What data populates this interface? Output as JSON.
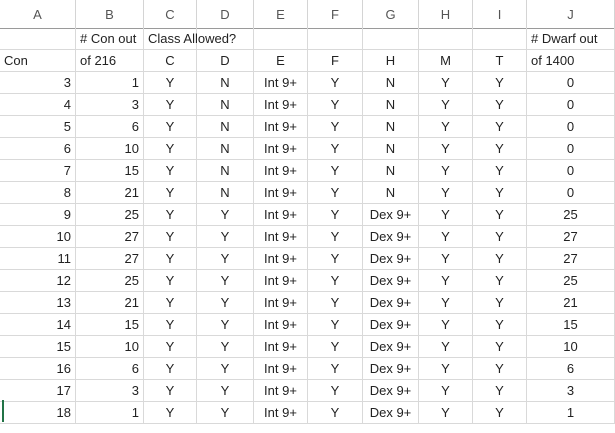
{
  "columns": [
    "A",
    "B",
    "C",
    "D",
    "E",
    "F",
    "G",
    "H",
    "I",
    "J"
  ],
  "header_row1": {
    "B": "# Con out",
    "C": "Class Allowed?",
    "J": "# Dwarf out"
  },
  "header_row2": {
    "A": "Con",
    "B": "of 216",
    "C": "C",
    "D": "D",
    "E": "E",
    "F": "F",
    "G": "H",
    "H": "M",
    "I": "T",
    "J": "of 1400"
  },
  "rows": [
    {
      "A": "3",
      "B": "1",
      "C": "Y",
      "D": "N",
      "E": "Int 9+",
      "F": "Y",
      "G": "N",
      "H": "Y",
      "I": "Y",
      "J": "0"
    },
    {
      "A": "4",
      "B": "3",
      "C": "Y",
      "D": "N",
      "E": "Int 9+",
      "F": "Y",
      "G": "N",
      "H": "Y",
      "I": "Y",
      "J": "0"
    },
    {
      "A": "5",
      "B": "6",
      "C": "Y",
      "D": "N",
      "E": "Int 9+",
      "F": "Y",
      "G": "N",
      "H": "Y",
      "I": "Y",
      "J": "0"
    },
    {
      "A": "6",
      "B": "10",
      "C": "Y",
      "D": "N",
      "E": "Int 9+",
      "F": "Y",
      "G": "N",
      "H": "Y",
      "I": "Y",
      "J": "0"
    },
    {
      "A": "7",
      "B": "15",
      "C": "Y",
      "D": "N",
      "E": "Int 9+",
      "F": "Y",
      "G": "N",
      "H": "Y",
      "I": "Y",
      "J": "0"
    },
    {
      "A": "8",
      "B": "21",
      "C": "Y",
      "D": "N",
      "E": "Int 9+",
      "F": "Y",
      "G": "N",
      "H": "Y",
      "I": "Y",
      "J": "0"
    },
    {
      "A": "9",
      "B": "25",
      "C": "Y",
      "D": "Y",
      "E": "Int 9+",
      "F": "Y",
      "G": "Dex 9+",
      "H": "Y",
      "I": "Y",
      "J": "25"
    },
    {
      "A": "10",
      "B": "27",
      "C": "Y",
      "D": "Y",
      "E": "Int 9+",
      "F": "Y",
      "G": "Dex 9+",
      "H": "Y",
      "I": "Y",
      "J": "27"
    },
    {
      "A": "11",
      "B": "27",
      "C": "Y",
      "D": "Y",
      "E": "Int 9+",
      "F": "Y",
      "G": "Dex 9+",
      "H": "Y",
      "I": "Y",
      "J": "27"
    },
    {
      "A": "12",
      "B": "25",
      "C": "Y",
      "D": "Y",
      "E": "Int 9+",
      "F": "Y",
      "G": "Dex 9+",
      "H": "Y",
      "I": "Y",
      "J": "25"
    },
    {
      "A": "13",
      "B": "21",
      "C": "Y",
      "D": "Y",
      "E": "Int 9+",
      "F": "Y",
      "G": "Dex 9+",
      "H": "Y",
      "I": "Y",
      "J": "21"
    },
    {
      "A": "14",
      "B": "15",
      "C": "Y",
      "D": "Y",
      "E": "Int 9+",
      "F": "Y",
      "G": "Dex 9+",
      "H": "Y",
      "I": "Y",
      "J": "15"
    },
    {
      "A": "15",
      "B": "10",
      "C": "Y",
      "D": "Y",
      "E": "Int 9+",
      "F": "Y",
      "G": "Dex 9+",
      "H": "Y",
      "I": "Y",
      "J": "10"
    },
    {
      "A": "16",
      "B": "6",
      "C": "Y",
      "D": "Y",
      "E": "Int 9+",
      "F": "Y",
      "G": "Dex 9+",
      "H": "Y",
      "I": "Y",
      "J": "6"
    },
    {
      "A": "17",
      "B": "3",
      "C": "Y",
      "D": "Y",
      "E": "Int 9+",
      "F": "Y",
      "G": "Dex 9+",
      "H": "Y",
      "I": "Y",
      "J": "3"
    },
    {
      "A": "18",
      "B": "1",
      "C": "Y",
      "D": "Y",
      "E": "Int 9+",
      "F": "Y",
      "G": "Dex 9+",
      "H": "Y",
      "I": "Y",
      "J": "1"
    }
  ]
}
